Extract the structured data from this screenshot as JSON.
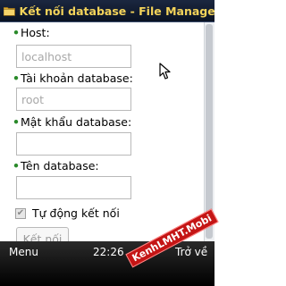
{
  "window": {
    "title": "Kết nối database - File Manager ..."
  },
  "form": {
    "host": {
      "label": "Host:",
      "value": "localhost"
    },
    "account": {
      "label": "Tài khoản database:",
      "value": "root"
    },
    "password": {
      "label": "Mật khẩu database:",
      "value": ""
    },
    "dbname": {
      "label": "Tên database:",
      "value": ""
    },
    "auto_connect": {
      "label": "Tự động kết nối",
      "checked": true,
      "check_glyph": "✔"
    },
    "connect_button": {
      "label": "Kết nối"
    }
  },
  "softkeys": {
    "left": "Menu",
    "time": "22:26",
    "right": "Trở về"
  },
  "watermark": {
    "text": "KenhLMHT.Mobi"
  },
  "icons": {
    "title_icon": "folder-icon",
    "cursor": "mouse-pointer-icon"
  },
  "colors": {
    "title_text": "#f3d35a",
    "required_dot": "#2a8a2a",
    "watermark_bg": "#c41515"
  }
}
